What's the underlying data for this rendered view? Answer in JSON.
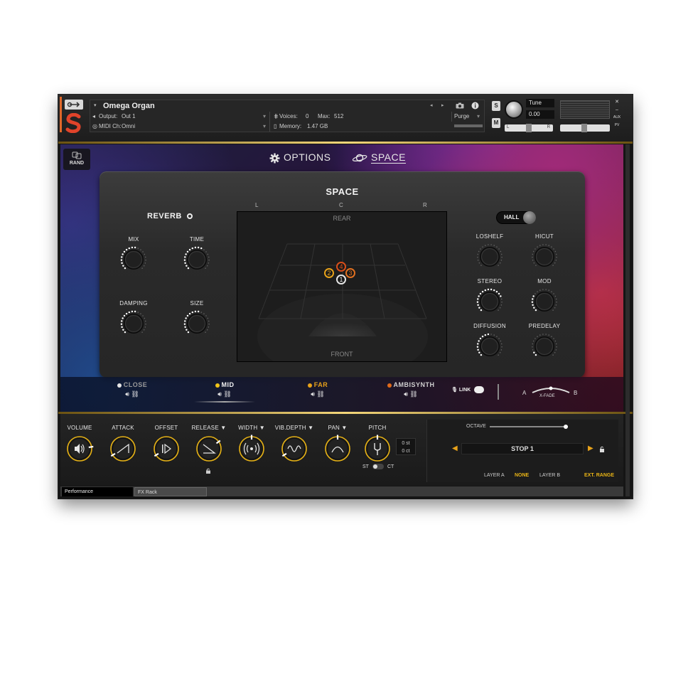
{
  "header": {
    "instrument_name": "Omega Organ",
    "output_label": "Output:",
    "output_value": "Out 1",
    "midi_label": "MIDI Ch:",
    "midi_value": "Omni",
    "voices_label": "Voices:",
    "voices_value": "0",
    "max_label": "Max:",
    "max_value": "512",
    "memory_label": "Memory:",
    "memory_value": "1.47 GB",
    "purge_label": "Purge",
    "s_button": "S",
    "m_button": "M",
    "tune_label": "Tune",
    "tune_value": "0.00",
    "pan_left": "L",
    "pan_right": "R",
    "aux_label": "AUX",
    "pv_label": "PV"
  },
  "rand_label": "RAND",
  "tabs": [
    {
      "label": "OPTIONS",
      "icon": "gear-icon"
    },
    {
      "label": "SPACE",
      "icon": "planet-icon",
      "active": true
    }
  ],
  "space": {
    "title": "SPACE",
    "reverb_label": "REVERB",
    "reverb_knobs": [
      {
        "label": "MIX",
        "value": 0.55
      },
      {
        "label": "TIME",
        "value": 0.6
      },
      {
        "label": "DAMPING",
        "value": 0.55
      },
      {
        "label": "SIZE",
        "value": 0.55
      }
    ],
    "stage": {
      "axis_left": "L",
      "axis_center": "C",
      "axis_right": "R",
      "rear": "REAR",
      "front": "FRONT",
      "markers": [
        {
          "label": "1",
          "color": "#e6e6e6"
        },
        {
          "label": "2",
          "color": "#e8a21a"
        },
        {
          "label": "3",
          "color": "#e07020"
        },
        {
          "label": "4",
          "color": "#d94e1a"
        }
      ]
    },
    "hall_label": "HALL",
    "eq_knobs": [
      {
        "label": "LOSHELF",
        "value": 0.0
      },
      {
        "label": "HICUT",
        "value": 0.0
      },
      {
        "label": "STEREO",
        "value": 0.75
      },
      {
        "label": "MOD",
        "value": 0.3
      },
      {
        "label": "DIFFUSION",
        "value": 0.5
      },
      {
        "label": "PREDELAY",
        "value": 0.1
      }
    ]
  },
  "mics": [
    {
      "name": "CLOSE",
      "color": "#e6e6e6",
      "name_color": "#9a9a9a"
    },
    {
      "name": "MID",
      "color": "#f0c419",
      "name_color": "#f2f2f2"
    },
    {
      "name": "FAR",
      "color": "#e8a21a",
      "name_color": "#e8a21a"
    },
    {
      "name": "AMBISYNTH",
      "color": "#e06a1a",
      "name_color": "#cfcfcf"
    }
  ],
  "link_label": "LINK",
  "xfade": {
    "a": "A",
    "label": "X-FADE",
    "b": "B"
  },
  "bottom": {
    "knobs": [
      {
        "label": "VOLUME",
        "icon": "speaker-icon",
        "value": 0.8
      },
      {
        "label": "ATTACK",
        "icon": "ramp-icon",
        "value": 0.05
      },
      {
        "label": "OFFSET",
        "icon": "play-icon",
        "value": 0.05
      },
      {
        "label": "RELEASE ▼",
        "icon": "decay-icon",
        "value": 0.7
      },
      {
        "label": "WIDTH ▼",
        "icon": "broadcast-icon",
        "value": 0.5
      },
      {
        "label": "VIB.DEPTH ▼",
        "icon": "wave-icon",
        "value": 0.05
      },
      {
        "label": "PAN ▼",
        "icon": "pan-icon",
        "value": 0.5
      },
      {
        "label": "PITCH",
        "icon": "tuning-fork-icon",
        "value": 0.5
      }
    ],
    "pitch_st": "0 st",
    "pitch_ct": "0 ct",
    "st_label": "ST",
    "ct_label": "CT",
    "octave_label": "OCTAVE",
    "stop_label": "STOP 1",
    "layer_a_label": "LAYER A",
    "layer_a_value": "NONE",
    "layer_b_label": "LAYER B",
    "ext_range_label": "EXT. RANGE"
  },
  "footer": {
    "tab_performance": "Performance",
    "tab_fxrack": "FX Rack"
  },
  "colors": {
    "accent_gold": "#e8b315",
    "accent_orange": "#e0682a"
  }
}
